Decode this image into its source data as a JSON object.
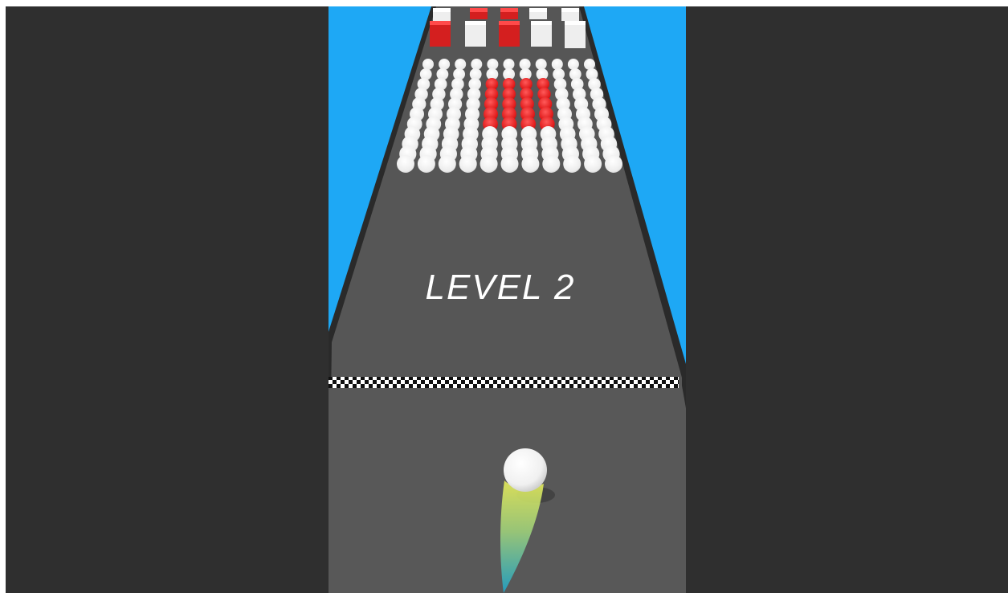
{
  "game": {
    "level_label": "LEVEL 2"
  },
  "colors": {
    "letterbox": "#2f2f2f",
    "sky": "#1ea8f5",
    "track": "#555555",
    "track_edge": "#2a2a2a",
    "ball_white": "#f2f2f2",
    "ball_red": "#e01b1b",
    "block_red": "#d41f1f",
    "block_white": "#eeeeee",
    "player_ball": "#ffffff",
    "trail_top": "#e7ec5a",
    "trail_bottom": "#1fa3c8"
  }
}
